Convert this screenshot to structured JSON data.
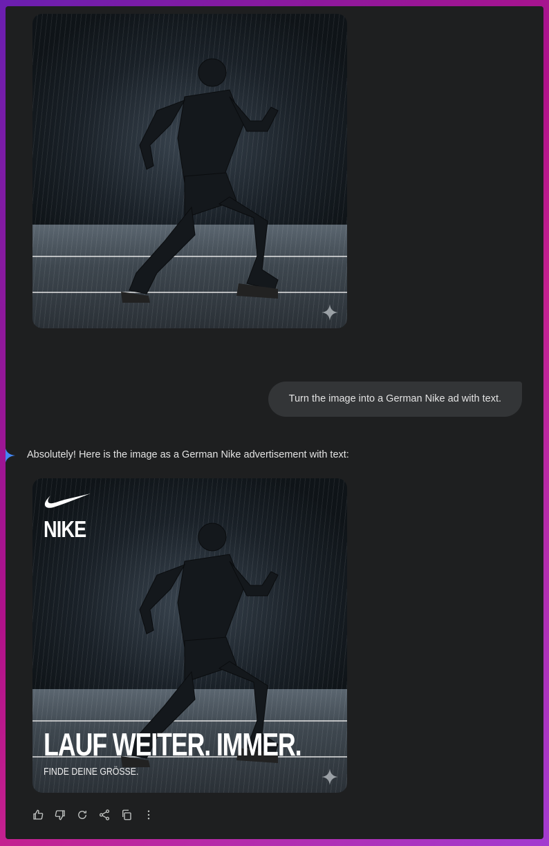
{
  "conversation": {
    "user_prompt": "Turn the image into a German Nike ad with text.",
    "assistant_reply": "Absolutely! Here is the image as a German Nike advertisement with text:"
  },
  "ad": {
    "brand": "NIKE",
    "headline": "LAUF WEITER. IMMER.",
    "subline": "FINDE DEINE GRÖSSE."
  },
  "icons": {
    "sparkle": "sparkle-icon",
    "gemini": "gemini-icon",
    "actions": [
      "thumbs-up-icon",
      "thumbs-down-icon",
      "redo-icon",
      "share-icon",
      "copy-icon",
      "more-options-icon"
    ]
  },
  "colors": {
    "panel": "#1e1f20",
    "bubble": "#333537",
    "text": "#e3e3e3",
    "accent": "#4285f4"
  }
}
